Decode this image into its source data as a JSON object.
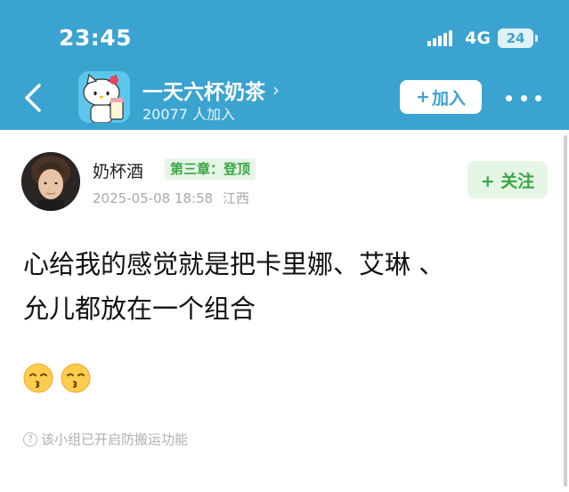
{
  "status_bar": {
    "time": "23:45",
    "network": "4G",
    "battery": "24",
    "signal_icon": "signal-bars-icon"
  },
  "group": {
    "name": "一天六杯奶茶",
    "members": "20077 人加入",
    "join_label": "加入",
    "join_icon": "+",
    "back_icon": "chevron-left-icon",
    "more_icon": "more-dots-icon",
    "accent_color": "#3ba3d0"
  },
  "post": {
    "author": "奶杯酒",
    "badge": "第三章：登顶",
    "timestamp": "2025-05-08 18:58",
    "location": "江西",
    "follow_label": "+ 关注",
    "body_line1": "心给我的感觉就是把卡里娜、艾琳 、",
    "body_line2": "允儿都放在一个组合",
    "emojis": [
      "kissing-face-with-smiling-eyes-icon",
      "kissing-face-with-smiling-eyes-icon"
    ],
    "badge_color": "#3aa547"
  },
  "footer": {
    "note": "该小组已开启防搬运功能",
    "note_icon": "?"
  }
}
